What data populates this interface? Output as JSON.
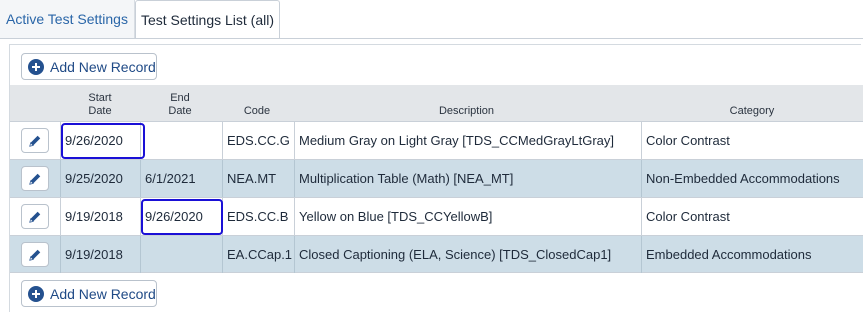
{
  "tabs": [
    {
      "label": "Active Test Settings",
      "active": false
    },
    {
      "label": "Test Settings List (all)",
      "active": true
    }
  ],
  "add_record_label": "Add New Record",
  "headers": {
    "start_l1": "Start",
    "start_l2": "Date",
    "end_l1": "End",
    "end_l2": "Date",
    "code": "Code",
    "description": "Description",
    "category": "Category"
  },
  "rows": [
    {
      "start": "9/26/2020",
      "end": "",
      "code": "EDS.CC.G",
      "description": "Medium Gray on Light Gray [TDS_CCMedGrayLtGray]",
      "category": "Color Contrast",
      "highlight": "start"
    },
    {
      "start": "9/25/2020",
      "end": "6/1/2021",
      "code": "NEA.MT",
      "description": "Multiplication Table (Math) [NEA_MT]",
      "category": "Non-Embedded Accommodations",
      "highlight": ""
    },
    {
      "start": "9/19/2018",
      "end": "9/26/2020",
      "code": "EDS.CC.B",
      "description": "Yellow on Blue [TDS_CCYellowB]",
      "category": "Color Contrast",
      "highlight": "end"
    },
    {
      "start": "9/19/2018",
      "end": "",
      "code": "EA.CCap.1",
      "description": "Closed Captioning (ELA, Science) [TDS_ClosedCap1]",
      "category": "Embedded Accommodations",
      "highlight": ""
    }
  ],
  "colors": {
    "accent": "#24518f",
    "highlight_border": "#1a10d6",
    "row_shade": "#cddde7",
    "header_bg": "#e3e6e9"
  },
  "icons": {
    "add": "plus-circle-icon",
    "edit": "pencil-icon"
  }
}
